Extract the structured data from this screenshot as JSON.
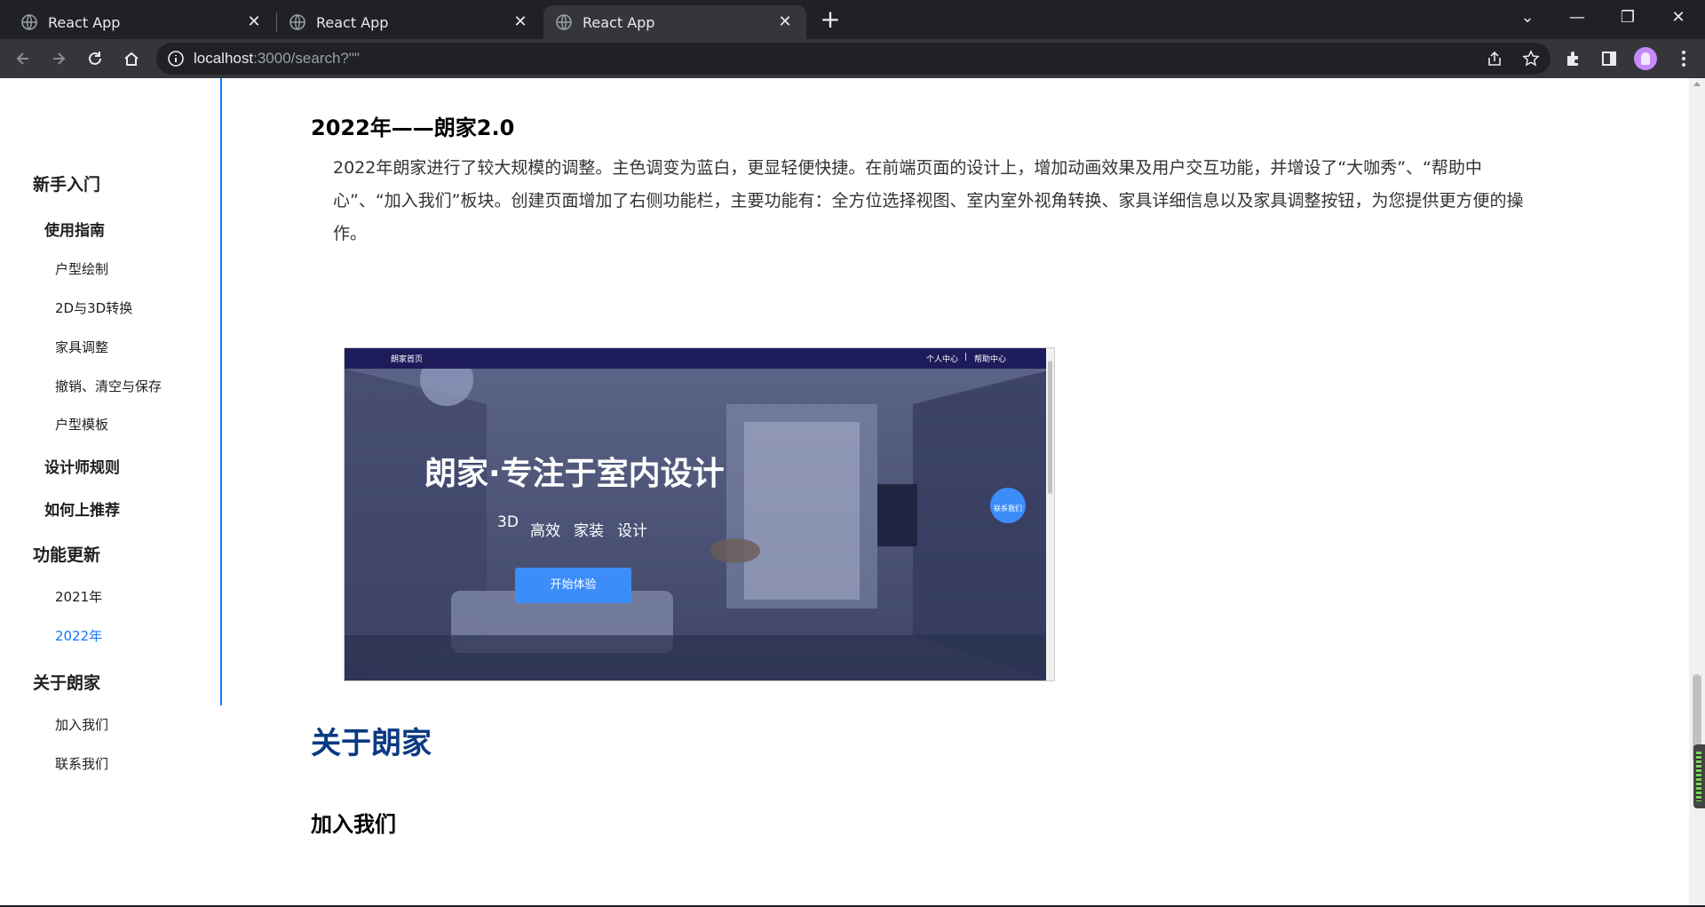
{
  "browser": {
    "tabs": [
      {
        "title": "React App",
        "active": false
      },
      {
        "title": "React App",
        "active": false
      },
      {
        "title": "React App",
        "active": true
      }
    ],
    "url_host": "localhost",
    "url_path": ":3000/search?\"\"",
    "icons": {
      "back": "arrow-left-icon",
      "forward": "arrow-right-icon",
      "reload": "reload-icon",
      "home": "home-icon",
      "share": "share-icon",
      "bookmark": "star-icon",
      "extensions": "puzzle-icon",
      "sidepanel": "side-panel-icon",
      "menu": "kebab-menu-icon"
    }
  },
  "sidebar": {
    "items": [
      {
        "label": "新手入门",
        "level": 1
      },
      {
        "label": "使用指南",
        "level": 2
      },
      {
        "label": "户型绘制",
        "level": 3
      },
      {
        "label": "2D与3D转换",
        "level": 3
      },
      {
        "label": "家具调整",
        "level": 3
      },
      {
        "label": "撤销、清空与保存",
        "level": 3
      },
      {
        "label": "户型模板",
        "level": 3
      },
      {
        "label": "设计师规则",
        "level": 2
      },
      {
        "label": "如何上推荐",
        "level": 2
      },
      {
        "label": "功能更新",
        "level": 1
      },
      {
        "label": "2021年",
        "level": 3
      },
      {
        "label": "2022年",
        "level": 3,
        "active": true
      },
      {
        "label": "关于朗家",
        "level": 1
      },
      {
        "label": "加入我们",
        "level": 3
      },
      {
        "label": "联系我们",
        "level": 3
      }
    ],
    "accent_color": "#1677ff"
  },
  "content": {
    "heading_2022": "2022年——朗家2.0",
    "paragraph_2022": "2022年朗家进行了较大规模的调整。主色调变为蓝白，更显轻便快捷。在前端页面的设计上，增加动画效果及用户交互功能，并增设了“大咖秀”、“帮助中心”、“加入我们”板块。创建页面增加了右侧功能栏，主要功能有：全方位选择视图、室内室外视角转换、家具详细信息以及家具调整按钮，为您提供更方便的操作。",
    "screenshot": {
      "nav_home": "朗家首页",
      "nav_personal": "个人中心",
      "nav_sep": "|",
      "nav_help": "帮助中心",
      "title": "朗家·专注于室内设计",
      "tags": [
        "3D",
        "高效",
        "家装",
        "设计"
      ],
      "cta": "开始体验",
      "float_label": "联系我们"
    },
    "heading_about": "关于朗家",
    "heading_join": "加入我们"
  }
}
